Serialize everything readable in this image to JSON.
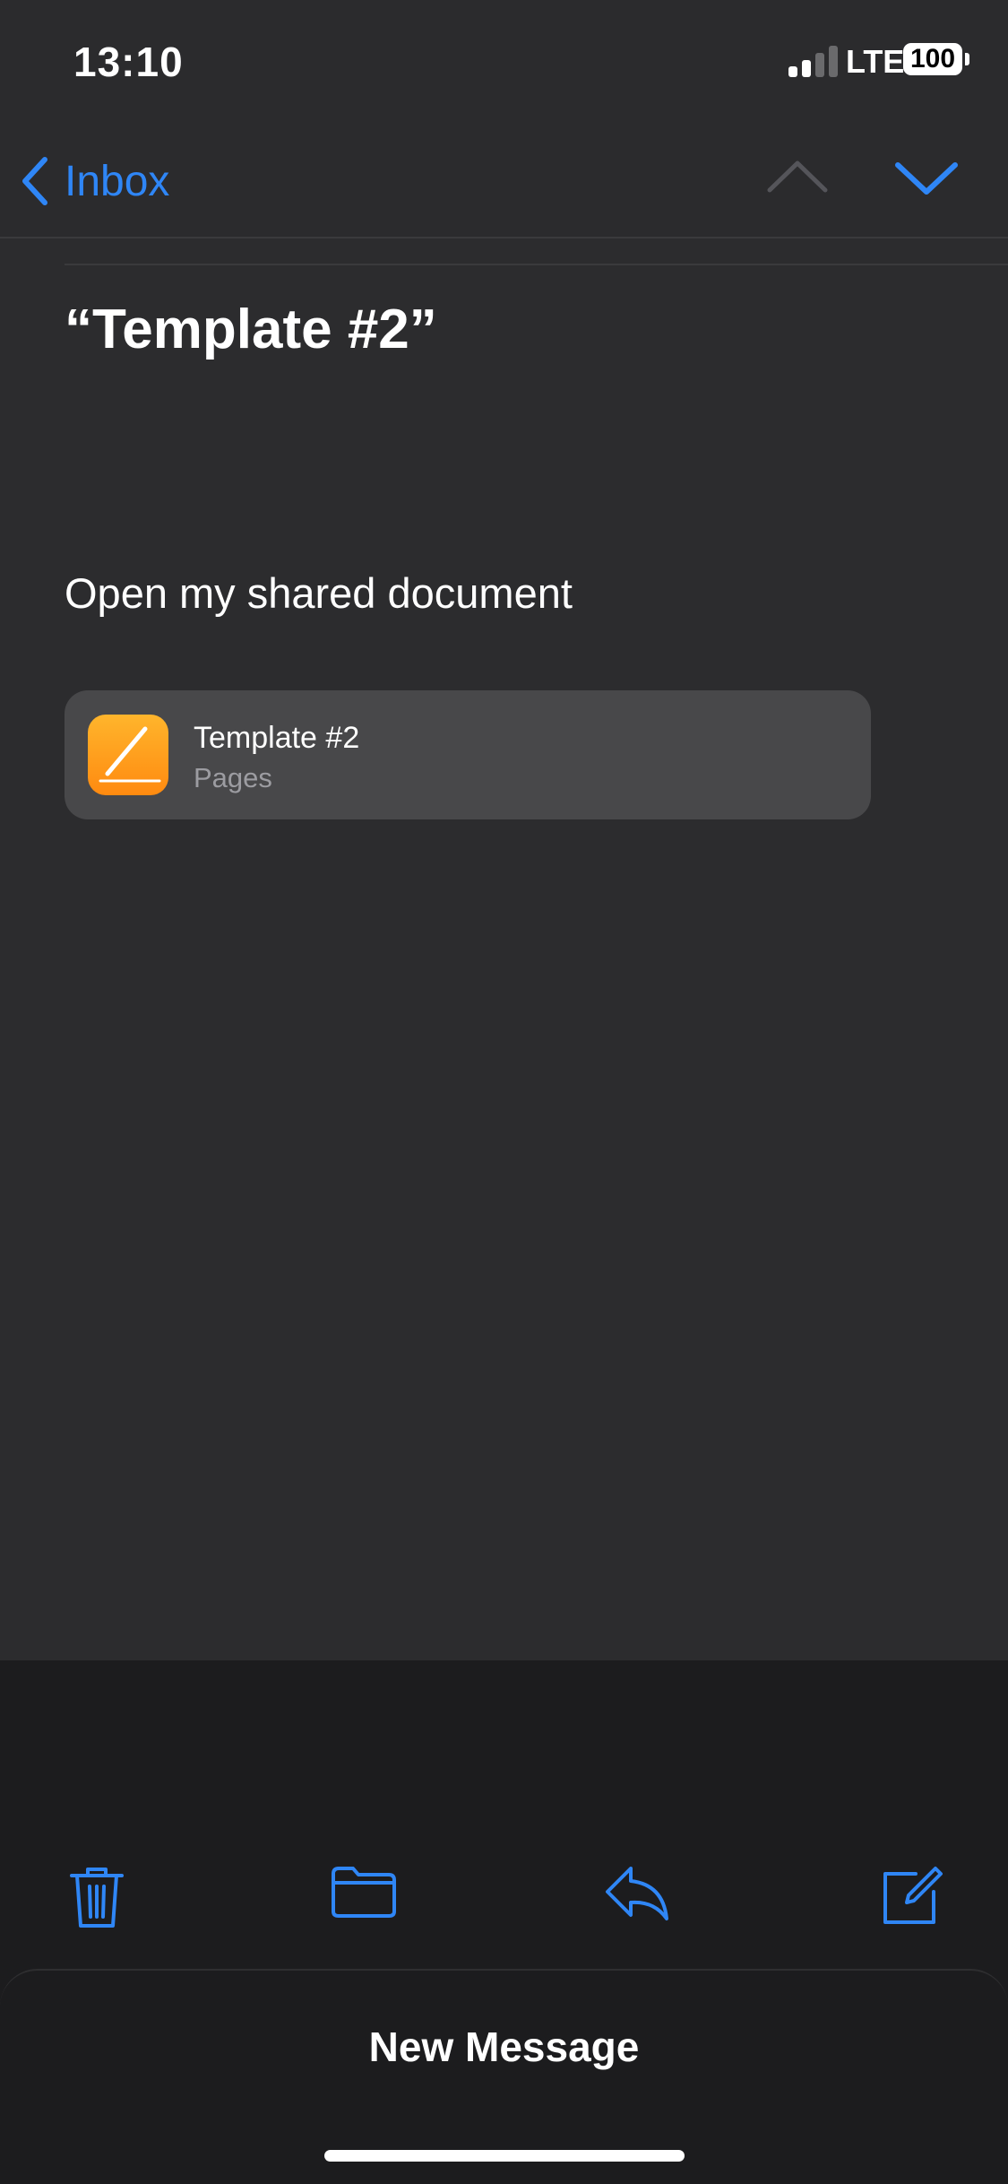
{
  "status_bar": {
    "time": "13:10",
    "network": "LTE",
    "battery": "100"
  },
  "nav": {
    "back_label": "Inbox"
  },
  "message": {
    "subject": "“Template #2”",
    "body": "Open my shared document",
    "attachment": {
      "title": "Template #2",
      "app": "Pages"
    }
  },
  "draft": {
    "title": "New Message"
  },
  "icons": {
    "back": "chevron-left-icon",
    "previous": "chevron-up-icon",
    "next": "chevron-down-icon",
    "trash": "trash-icon",
    "folder": "folder-icon",
    "reply": "reply-icon",
    "compose": "compose-icon",
    "attachment": "pages-app-icon"
  },
  "colors": {
    "accent": "#2f86f6",
    "background": "#2c2c2e",
    "attachment_bg": "#48484a",
    "pages_orange": "#ff9a1a"
  }
}
